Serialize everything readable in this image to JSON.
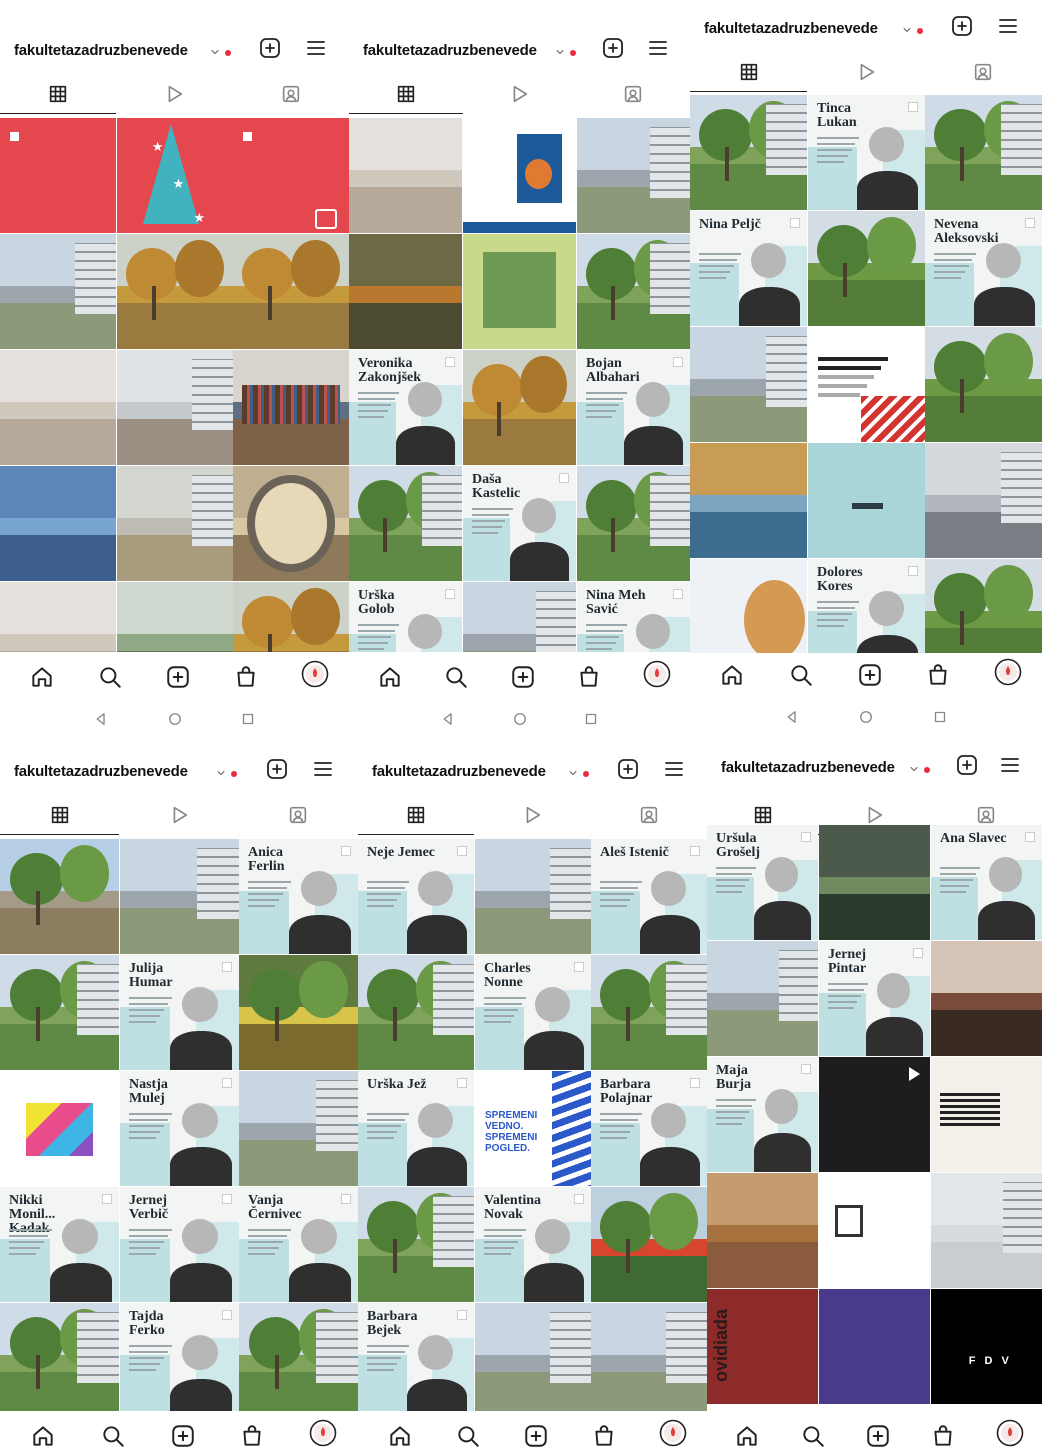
{
  "account": {
    "username": "fakultetazadruzbenevede",
    "chevron_icon": "chevron-down-icon",
    "notification_dot_color": "#ed2a3f"
  },
  "header_icons": [
    "new-post-icon",
    "menu-icon"
  ],
  "profile_tabs": [
    {
      "icon": "grid-icon",
      "active": true
    },
    {
      "icon": "reels-icon",
      "active": false
    },
    {
      "icon": "tagged-icon",
      "active": false
    }
  ],
  "bottom_nav": [
    "home-icon",
    "search-icon",
    "create-icon",
    "shop-icon",
    "profile-avatar-icon"
  ],
  "system_nav": [
    "back-icon",
    "home-circle-icon",
    "recents-icon"
  ],
  "screenshots": [
    {
      "cells": [
        {
          "kind": "post",
          "style": "red-doc"
        },
        {
          "kind": "post",
          "style": "red-tree"
        },
        {
          "kind": "post",
          "style": "red-gift"
        },
        {
          "kind": "photo",
          "style": "building"
        },
        {
          "kind": "photo",
          "style": "autumn"
        },
        {
          "kind": "photo",
          "style": "autumn"
        },
        {
          "kind": "photo",
          "style": "hallway"
        },
        {
          "kind": "photo",
          "style": "atrium"
        },
        {
          "kind": "photo",
          "style": "library"
        },
        {
          "kind": "photo",
          "style": "glass"
        },
        {
          "kind": "photo",
          "style": "courtyard"
        },
        {
          "kind": "photo",
          "style": "porthole"
        },
        {
          "kind": "photo",
          "style": "hallway"
        },
        {
          "kind": "photo",
          "style": "plants"
        },
        {
          "kind": "photo",
          "style": "autumn"
        }
      ]
    },
    {
      "cells": [
        {
          "kind": "photo",
          "style": "hallway"
        },
        {
          "kind": "post",
          "style": "book"
        },
        {
          "kind": "photo",
          "style": "building"
        },
        {
          "kind": "photo",
          "style": "leaf"
        },
        {
          "kind": "post",
          "style": "salad"
        },
        {
          "kind": "photo",
          "style": "park"
        },
        {
          "kind": "portrait",
          "name": "Veronika Zakonjšek"
        },
        {
          "kind": "photo",
          "style": "autumn"
        },
        {
          "kind": "portrait",
          "name": "Bojan Albahari"
        },
        {
          "kind": "photo",
          "style": "park"
        },
        {
          "kind": "portrait",
          "name": "Daša Kastelic"
        },
        {
          "kind": "photo",
          "style": "park"
        },
        {
          "kind": "portrait",
          "name": "Urška Golob"
        },
        {
          "kind": "photo",
          "style": "building"
        },
        {
          "kind": "portrait",
          "name": "Nina Meh Savić"
        }
      ]
    },
    {
      "cells": [
        {
          "kind": "photo",
          "style": "park"
        },
        {
          "kind": "portrait",
          "name": "Tinca Lukan"
        },
        {
          "kind": "photo",
          "style": "park"
        },
        {
          "kind": "portrait",
          "name": "Nina Peljč"
        },
        {
          "kind": "photo",
          "style": "trees"
        },
        {
          "kind": "portrait",
          "name": "Nevena Aleksovski"
        },
        {
          "kind": "photo",
          "style": "building"
        },
        {
          "kind": "post",
          "style": "white-flag"
        },
        {
          "kind": "photo",
          "style": "trees"
        },
        {
          "kind": "photo",
          "style": "office"
        },
        {
          "kind": "post",
          "style": "teal-doc"
        },
        {
          "kind": "photo",
          "style": "hall"
        },
        {
          "kind": "post",
          "style": "man-circle"
        },
        {
          "kind": "portrait",
          "name": "Dolores Kores"
        },
        {
          "kind": "photo",
          "style": "trees"
        }
      ]
    },
    {
      "cells": [
        {
          "kind": "photo",
          "style": "bikes"
        },
        {
          "kind": "photo",
          "style": "building"
        },
        {
          "kind": "portrait",
          "name": "Anica Ferlin"
        },
        {
          "kind": "photo",
          "style": "park"
        },
        {
          "kind": "portrait",
          "name": "Julija Humar"
        },
        {
          "kind": "photo",
          "style": "flowers"
        },
        {
          "kind": "post",
          "style": "colorful"
        },
        {
          "kind": "portrait",
          "name": "Nastja Mulej"
        },
        {
          "kind": "photo",
          "style": "building"
        },
        {
          "kind": "portrait",
          "name": "Nikki Monil... Kadak"
        },
        {
          "kind": "portrait",
          "name": "Jernej Verbič"
        },
        {
          "kind": "portrait",
          "name": "Vanja Černivec"
        },
        {
          "kind": "photo",
          "style": "park"
        },
        {
          "kind": "portrait",
          "name": "Tajda Ferko"
        },
        {
          "kind": "photo",
          "style": "park"
        }
      ]
    },
    {
      "cells": [
        {
          "kind": "portrait",
          "name": "Neje Jemec"
        },
        {
          "kind": "photo",
          "style": "building"
        },
        {
          "kind": "portrait",
          "name": "Aleš Istenič"
        },
        {
          "kind": "photo",
          "style": "park"
        },
        {
          "kind": "portrait",
          "name": "Charles Nonne"
        },
        {
          "kind": "photo",
          "style": "park"
        },
        {
          "kind": "portrait",
          "name": "Urška Jež"
        },
        {
          "kind": "post",
          "style": "zebra",
          "text": "SPREMENI VEDNO. SPREMENI POGLED."
        },
        {
          "kind": "portrait",
          "name": "Barbara Polajnar"
        },
        {
          "kind": "photo",
          "style": "park"
        },
        {
          "kind": "portrait",
          "name": "Valentina Novak"
        },
        {
          "kind": "photo",
          "style": "tulips"
        },
        {
          "kind": "portrait",
          "name": "Barbara Bejek"
        },
        {
          "kind": "photo",
          "style": "building"
        },
        {
          "kind": "photo",
          "style": "building"
        }
      ]
    },
    {
      "cells": [
        {
          "kind": "portrait",
          "name": "Uršula Grošelj"
        },
        {
          "kind": "photo",
          "style": "window"
        },
        {
          "kind": "portrait",
          "name": "Ana Slavec"
        },
        {
          "kind": "photo",
          "style": "building"
        },
        {
          "kind": "portrait",
          "name": "Jernej Pintar"
        },
        {
          "kind": "photo",
          "style": "selfie"
        },
        {
          "kind": "portrait",
          "name": "Maja Burja"
        },
        {
          "kind": "post",
          "style": "dark-video"
        },
        {
          "kind": "post",
          "style": "newspaper"
        },
        {
          "kind": "photo",
          "style": "city"
        },
        {
          "kind": "post",
          "style": "white-doc"
        },
        {
          "kind": "photo",
          "style": "pale"
        },
        {
          "kind": "post",
          "style": "red-sign",
          "text": "ovidiada"
        },
        {
          "kind": "post",
          "style": "purple-event"
        },
        {
          "kind": "post",
          "style": "black-fdv",
          "text": "F D V"
        }
      ]
    }
  ]
}
